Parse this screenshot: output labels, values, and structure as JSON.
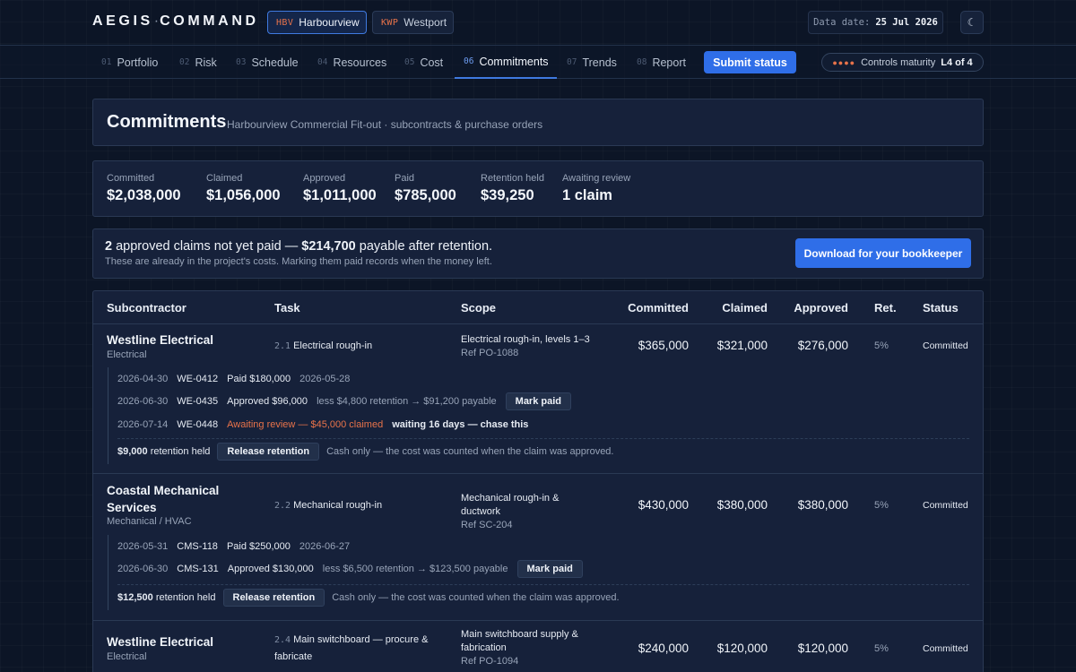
{
  "app": {
    "logo_left": "AEGIS",
    "logo_dot": "·",
    "logo_right": "COMMAND"
  },
  "projects": [
    {
      "code": "HBV",
      "name": "Harbourview",
      "active": true
    },
    {
      "code": "KWP",
      "name": "Westport",
      "active": false
    }
  ],
  "data_date": {
    "label": "Data date:",
    "value": "25 Jul 2026"
  },
  "theme_toggle_icon": "moon-icon",
  "nav": {
    "tabs": [
      {
        "num": "01",
        "label": "Portfolio"
      },
      {
        "num": "02",
        "label": "Risk"
      },
      {
        "num": "03",
        "label": "Schedule"
      },
      {
        "num": "04",
        "label": "Resources"
      },
      {
        "num": "05",
        "label": "Cost"
      },
      {
        "num": "06",
        "label": "Commitments",
        "active": true
      },
      {
        "num": "07",
        "label": "Trends"
      },
      {
        "num": "08",
        "label": "Report"
      }
    ],
    "submit_label": "Submit status",
    "maturity": {
      "dots": "●●●●",
      "label": "Controls maturity",
      "level": "L4 of 4"
    }
  },
  "page": {
    "title": "Commitments",
    "subtitle": "Harbourview Commercial Fit-out · subcontracts & purchase orders"
  },
  "stats": [
    {
      "label": "Committed",
      "value": "$2,038,000"
    },
    {
      "label": "Claimed",
      "value": "$1,056,000"
    },
    {
      "label": "Approved",
      "value": "$1,011,000"
    },
    {
      "label": "Paid",
      "value": "$785,000"
    },
    {
      "label": "Retention held",
      "value": "$39,250"
    },
    {
      "label": "Awaiting review",
      "value": "1 claim"
    }
  ],
  "alert": {
    "count": "2",
    "text1": "approved claims not yet paid —",
    "amount": "$214,700",
    "text2": "payable after retention.",
    "sub": "These are already in the project's costs. Marking them paid records when the money left.",
    "download_label": "Download for your bookkeeper"
  },
  "table": {
    "headers": {
      "subcontractor": "Subcontractor",
      "task": "Task",
      "scope": "Scope",
      "committed": "Committed",
      "claimed": "Claimed",
      "approved": "Approved",
      "ret": "Ret.",
      "status": "Status"
    },
    "rows": [
      {
        "name": "Westline Electrical",
        "trade": "Electrical",
        "task_code": "2.1",
        "task": "Electrical rough-in",
        "scope": "Electrical rough-in, levels 1–3",
        "ref": "Ref PO-1088",
        "committed": "$365,000",
        "claimed": "$321,000",
        "approved": "$276,000",
        "ret": "5%",
        "status": "Committed",
        "claims": [
          {
            "date": "2026-04-30",
            "id": "WE-0412",
            "text": "Paid $180,000",
            "extra": "2026-05-28"
          },
          {
            "date": "2026-06-30",
            "id": "WE-0435",
            "text": "Approved $96,000",
            "extra": "less $4,800 retention → $91,200 payable",
            "button": "Mark paid"
          },
          {
            "date": "2026-07-14",
            "id": "WE-0448",
            "text": "Awaiting review — $45,000 claimed",
            "extra": "waiting 16 days — chase this"
          }
        ],
        "retention": {
          "amount": "$9,000",
          "label": "retention held",
          "button": "Release retention",
          "note": "Cash only — the cost was counted when the claim was approved."
        }
      },
      {
        "name": "Coastal Mechanical Services",
        "trade": "Mechanical / HVAC",
        "task_code": "2.2",
        "task": "Mechanical rough-in",
        "scope": "Mechanical rough-in & ductwork",
        "ref": "Ref SC-204",
        "committed": "$430,000",
        "claimed": "$380,000",
        "approved": "$380,000",
        "ret": "5%",
        "status": "Committed",
        "claims": [
          {
            "date": "2026-05-31",
            "id": "CMS-118",
            "text": "Paid $250,000",
            "extra": "2026-06-27"
          },
          {
            "date": "2026-06-30",
            "id": "CMS-131",
            "text": "Approved $130,000",
            "extra": "less $6,500 retention → $123,500 payable",
            "button": "Mark paid"
          }
        ],
        "retention": {
          "amount": "$12,500",
          "label": "retention held",
          "button": "Release retention",
          "note": "Cash only — the cost was counted when the claim was approved."
        }
      },
      {
        "name": "Westline Electrical",
        "trade": "Electrical",
        "task_code": "2.4",
        "task": "Main switchboard — procure & fabricate",
        "scope": "Main switchboard supply & fabrication",
        "ref": "Ref PO-1094",
        "committed": "$240,000",
        "claimed": "$120,000",
        "approved": "$120,000",
        "ret": "5%",
        "status": "Committed"
      }
    ]
  }
}
